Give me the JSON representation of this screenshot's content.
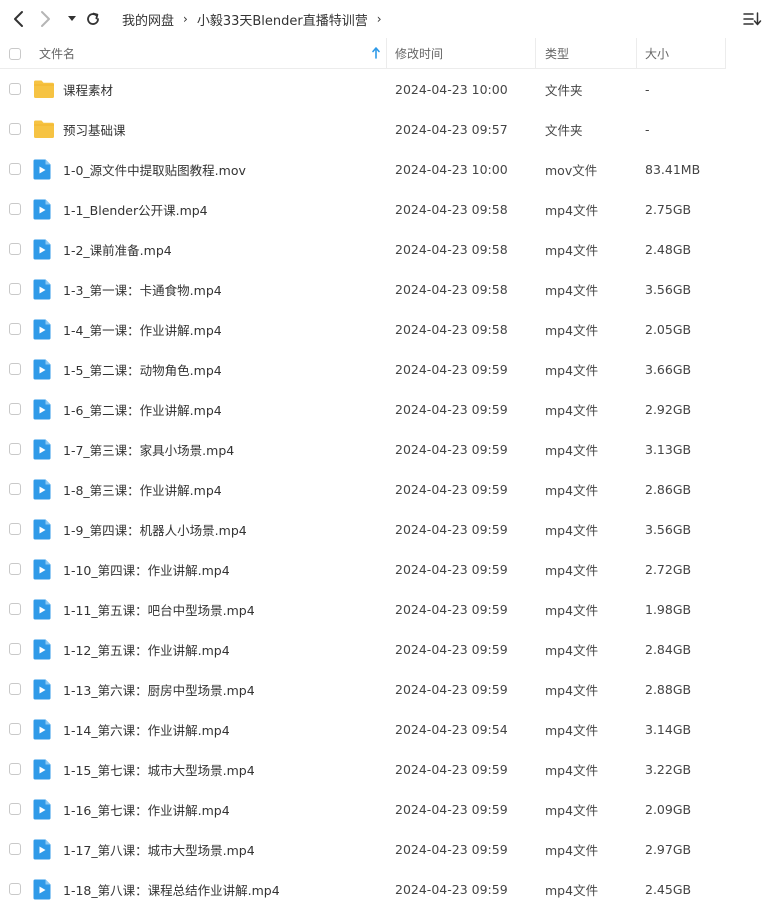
{
  "breadcrumbs": [
    {
      "label": "我的网盘"
    },
    {
      "label": "小毅33天Blender直播特训营"
    }
  ],
  "columns": {
    "name": "文件名",
    "modified": "修改时间",
    "type": "类型",
    "size": "大小"
  },
  "files": [
    {
      "name": "课程素材",
      "modified": "2024-04-23 10:00",
      "type": "文件夹",
      "size": "-",
      "icon": "folder"
    },
    {
      "name": "预习基础课",
      "modified": "2024-04-23 09:57",
      "type": "文件夹",
      "size": "-",
      "icon": "folder"
    },
    {
      "name": "1-0_源文件中提取贴图教程.mov",
      "modified": "2024-04-23 10:00",
      "type": "mov文件",
      "size": "83.41MB",
      "icon": "video"
    },
    {
      "name": "1-1_Blender公开课.mp4",
      "modified": "2024-04-23 09:58",
      "type": "mp4文件",
      "size": "2.75GB",
      "icon": "video"
    },
    {
      "name": "1-2_课前准备.mp4",
      "modified": "2024-04-23 09:58",
      "type": "mp4文件",
      "size": "2.48GB",
      "icon": "video"
    },
    {
      "name": "1-3_第一课：卡通食物.mp4",
      "modified": "2024-04-23 09:58",
      "type": "mp4文件",
      "size": "3.56GB",
      "icon": "video"
    },
    {
      "name": "1-4_第一课：作业讲解.mp4",
      "modified": "2024-04-23 09:58",
      "type": "mp4文件",
      "size": "2.05GB",
      "icon": "video"
    },
    {
      "name": "1-5_第二课：动物角色.mp4",
      "modified": "2024-04-23 09:59",
      "type": "mp4文件",
      "size": "3.66GB",
      "icon": "video"
    },
    {
      "name": "1-6_第二课：作业讲解.mp4",
      "modified": "2024-04-23 09:59",
      "type": "mp4文件",
      "size": "2.92GB",
      "icon": "video"
    },
    {
      "name": "1-7_第三课：家具小场景.mp4",
      "modified": "2024-04-23 09:59",
      "type": "mp4文件",
      "size": "3.13GB",
      "icon": "video"
    },
    {
      "name": "1-8_第三课：作业讲解.mp4",
      "modified": "2024-04-23 09:59",
      "type": "mp4文件",
      "size": "2.86GB",
      "icon": "video"
    },
    {
      "name": "1-9_第四课：机器人小场景.mp4",
      "modified": "2024-04-23 09:59",
      "type": "mp4文件",
      "size": "3.56GB",
      "icon": "video"
    },
    {
      "name": "1-10_第四课：作业讲解.mp4",
      "modified": "2024-04-23 09:59",
      "type": "mp4文件",
      "size": "2.72GB",
      "icon": "video"
    },
    {
      "name": "1-11_第五课：吧台中型场景.mp4",
      "modified": "2024-04-23 09:59",
      "type": "mp4文件",
      "size": "1.98GB",
      "icon": "video"
    },
    {
      "name": "1-12_第五课：作业讲解.mp4",
      "modified": "2024-04-23 09:59",
      "type": "mp4文件",
      "size": "2.84GB",
      "icon": "video"
    },
    {
      "name": "1-13_第六课：厨房中型场景.mp4",
      "modified": "2024-04-23 09:59",
      "type": "mp4文件",
      "size": "2.88GB",
      "icon": "video"
    },
    {
      "name": "1-14_第六课：作业讲解.mp4",
      "modified": "2024-04-23 09:54",
      "type": "mp4文件",
      "size": "3.14GB",
      "icon": "video"
    },
    {
      "name": "1-15_第七课：城市大型场景.mp4",
      "modified": "2024-04-23 09:59",
      "type": "mp4文件",
      "size": "3.22GB",
      "icon": "video"
    },
    {
      "name": "1-16_第七课：作业讲解.mp4",
      "modified": "2024-04-23 09:59",
      "type": "mp4文件",
      "size": "2.09GB",
      "icon": "video"
    },
    {
      "name": "1-17_第八课：城市大型场景.mp4",
      "modified": "2024-04-23 09:59",
      "type": "mp4文件",
      "size": "2.97GB",
      "icon": "video"
    },
    {
      "name": "1-18_第八课：课程总结作业讲解.mp4",
      "modified": "2024-04-23 09:59",
      "type": "mp4文件",
      "size": "2.45GB",
      "icon": "video"
    }
  ],
  "colors": {
    "folder": "#f6c343",
    "video": "#2f9ae8"
  }
}
